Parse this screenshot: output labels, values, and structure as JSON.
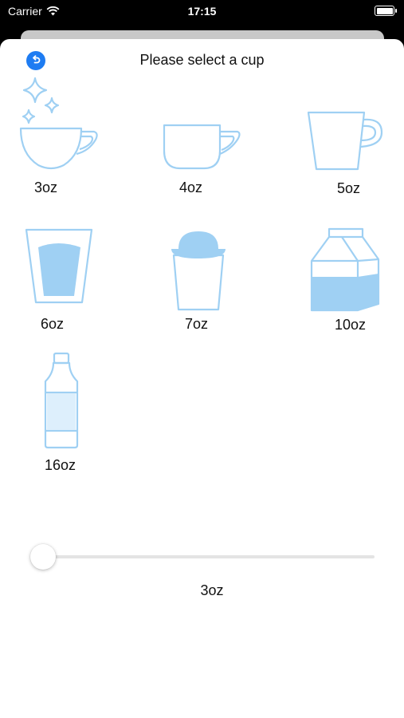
{
  "status_bar": {
    "carrier": "Carrier",
    "time": "17:15"
  },
  "header": {
    "title": "Please select a cup",
    "back_icon": "back-arrow-icon"
  },
  "accent_color": "#1e7cf2",
  "icon_color": "#9fd0f3",
  "cups": [
    {
      "label": "3oz",
      "icon": "teacup-sparkle-icon"
    },
    {
      "label": "4oz",
      "icon": "coffee-cup-icon"
    },
    {
      "label": "5oz",
      "icon": "mug-icon"
    },
    {
      "label": "6oz",
      "icon": "glass-icon"
    },
    {
      "label": "7oz",
      "icon": "lidded-cup-icon"
    },
    {
      "label": "10oz",
      "icon": "milk-carton-icon"
    },
    {
      "label": "16oz",
      "icon": "bottle-icon"
    }
  ],
  "slider": {
    "value_label": "3oz",
    "level": 0
  }
}
